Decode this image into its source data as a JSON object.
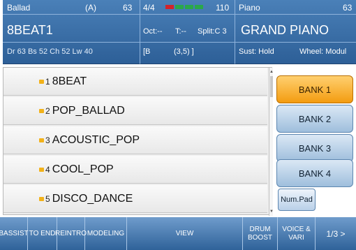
{
  "style_panel": {
    "category": "Ballad",
    "variation": "(A)",
    "volume": "63",
    "name": "8BEAT1",
    "levels": "Dr 63  Bs 52  Ch 52  Lw 40"
  },
  "mid_panel": {
    "time_sig": "4/4",
    "tempo": "110",
    "octave": "Oct:--",
    "transpose": "T:--",
    "split": "Split:C 3",
    "chord_open": "[B",
    "chord_value": "(3,5) ]"
  },
  "voice_panel": {
    "category": "Piano",
    "volume": "63",
    "name": "GRAND PIANO",
    "sustain": "Sust: Hold",
    "wheel": "Wheel: Modul"
  },
  "style_list": [
    {
      "num": "1",
      "name": "8BEAT"
    },
    {
      "num": "2",
      "name": "POP_BALLAD"
    },
    {
      "num": "3",
      "name": "ACOUSTIC_POP"
    },
    {
      "num": "4",
      "name": "COOL_POP"
    },
    {
      "num": "5",
      "name": "DISCO_DANCE"
    }
  ],
  "banks": [
    {
      "label": "BANK 1",
      "selected": true
    },
    {
      "label": "BANK 2",
      "selected": false
    },
    {
      "label": "BANK 3",
      "selected": false
    },
    {
      "label": "BANK 4",
      "selected": false
    }
  ],
  "numpad_label": "Num.Pad",
  "function_bar": {
    "bassist": "BASSIST",
    "to_end": "TO END",
    "reintro": "REINTRO",
    "modeling": "MODELING",
    "view": "VIEW",
    "drum_boost_1": "DRUM",
    "drum_boost_2": "BOOST",
    "voice_vari_1": "VOICE &",
    "voice_vari_2": "VARI",
    "page": "1/3 >"
  },
  "colors": {
    "header_blue": "#2d5f97",
    "bank_selected": "#f39c10",
    "tempo_led_red": "#d2232a",
    "tempo_led_green": "#2aa84a",
    "bullet": "#f2b21a"
  },
  "icons": [
    "tempo-led-indicator",
    "scroll-up-arrow-icon",
    "scroll-down-arrow-icon",
    "list-bullet-icon"
  ]
}
